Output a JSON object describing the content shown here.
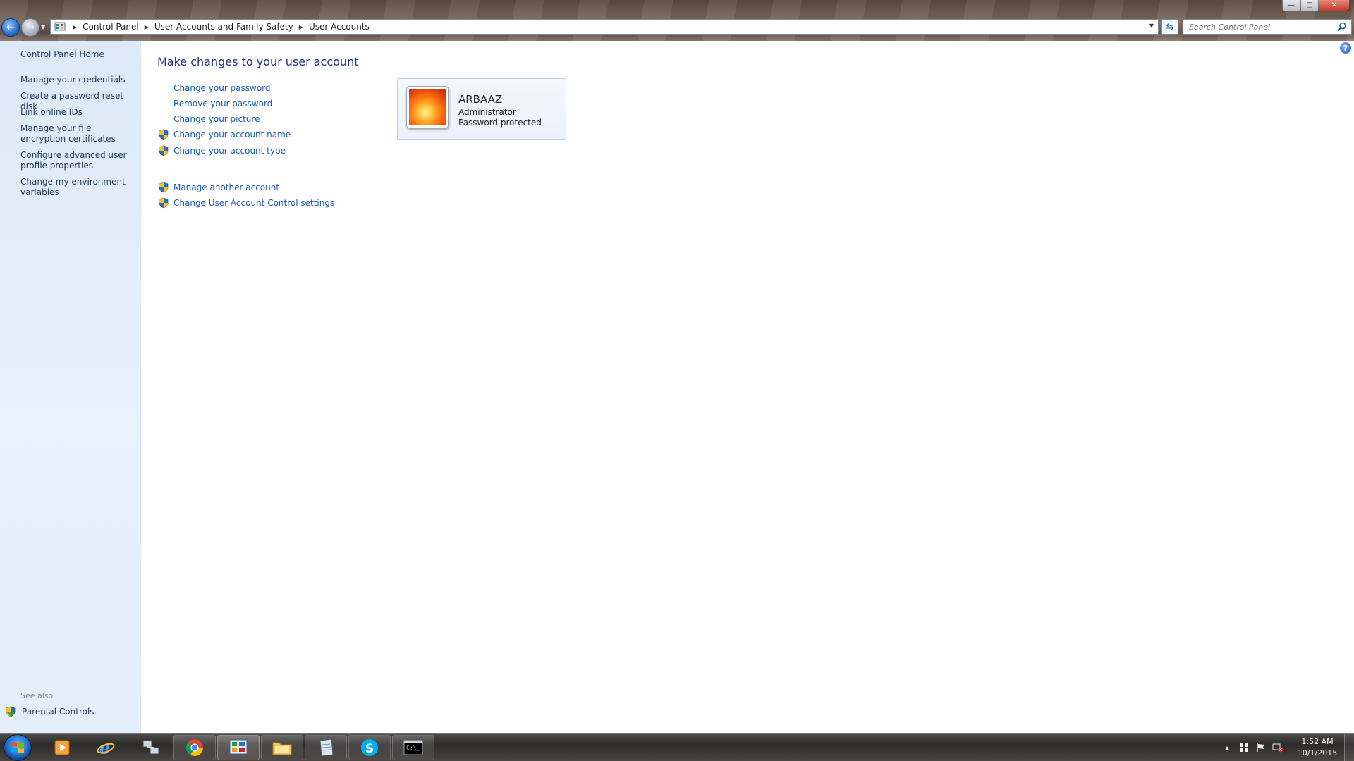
{
  "window": {
    "controls": {
      "minimize": "—",
      "maximize": "□",
      "close": "✕"
    }
  },
  "address": {
    "breadcrumbs": [
      "Control Panel",
      "User Accounts and Family Safety",
      "User Accounts"
    ],
    "search_placeholder": "Search Control Panel"
  },
  "sidebar": {
    "home": "Control Panel Home",
    "links": [
      "Manage your credentials",
      "Create a password reset disk",
      "Link online IDs",
      "Manage your file encryption certificates",
      "Configure advanced user profile properties",
      "Change my environment variables"
    ],
    "see_also": "See also",
    "see_also_links": [
      "Parental Controls"
    ]
  },
  "main": {
    "title": "Make changes to your user account",
    "tasks": [
      {
        "label": "Change your password",
        "shield": false
      },
      {
        "label": "Remove your password",
        "shield": false
      },
      {
        "label": "Change your picture",
        "shield": false
      },
      {
        "label": "Change your account name",
        "shield": true
      },
      {
        "label": "Change your account type",
        "shield": true
      }
    ],
    "other_tasks": [
      {
        "label": "Manage another account",
        "shield": true
      },
      {
        "label": "Change User Account Control settings",
        "shield": true
      }
    ],
    "account": {
      "name": "ARBAAZ",
      "role": "Administrator",
      "status": "Password protected"
    }
  },
  "taskbar": {
    "items": [
      {
        "icon": "media-player-icon",
        "state": "pinned"
      },
      {
        "icon": "internet-explorer-icon",
        "state": "pinned"
      },
      {
        "icon": "network-connections-icon",
        "state": "pinned"
      },
      {
        "icon": "chrome-icon",
        "state": "running"
      },
      {
        "icon": "control-panel-icon",
        "state": "active"
      },
      {
        "icon": "file-explorer-icon",
        "state": "running"
      },
      {
        "icon": "notepad-icon",
        "state": "running"
      },
      {
        "icon": "skype-icon",
        "state": "running"
      },
      {
        "icon": "command-prompt-icon",
        "state": "running"
      }
    ],
    "clock": {
      "time": "1:52 AM",
      "date": "10/1/2015"
    }
  },
  "colors": {
    "link": "#1c5ab3",
    "title": "#1e3287",
    "sidebar_link": "#1e395b",
    "sidebar_bg": "#e4eefa"
  }
}
